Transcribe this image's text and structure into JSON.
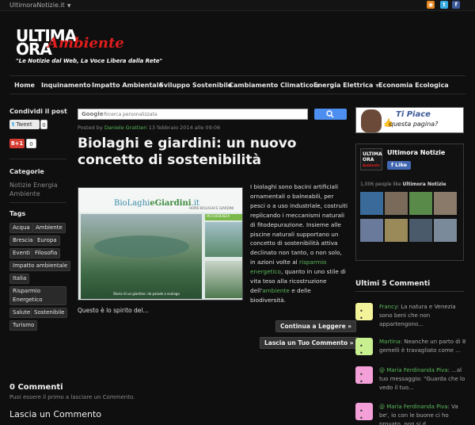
{
  "topbar": {
    "site_switch": "UltimoraNotizie.it"
  },
  "logo": {
    "ultima": "ULTIMA",
    "ora": "ORA",
    "ambiente": "Ambiente",
    "tagline": "\"Le Notizie dal Web, La Voce Libera dalla Rete\""
  },
  "nav": [
    {
      "label": "Home"
    },
    {
      "label": "Inquinamento"
    },
    {
      "label": "Impatto Ambientale"
    },
    {
      "label": "Sviluppo Sostenibile"
    },
    {
      "label": "Cambiamento Climatico"
    },
    {
      "label": "Energia Elettrica"
    },
    {
      "label": "Economia Ecologica"
    }
  ],
  "left": {
    "share_heading": "Condividi il post",
    "tweet_label": "Tweet",
    "tweet_count": "0",
    "gplus_label": "8+1",
    "gplus_count": "0",
    "categories_heading": "Categorie",
    "category": "Notizie Energia Ambiente",
    "tags_heading": "Tags",
    "tags": [
      "Acqua",
      "Ambiente",
      "Brescia",
      "Europa",
      "Eventi",
      "Filosofia",
      "Impatto ambientale",
      "Italia",
      "Risparmio Energetico",
      "Salute",
      "Sostenibile",
      "Turismo"
    ]
  },
  "search": {
    "brand": "Google",
    "placeholder": "Ricerca personalizzata"
  },
  "post": {
    "meta_prefix": "Posted by",
    "author": "Daniele Grattieri",
    "date": "13 febbraio 2014 alle 09:06",
    "title": "Biolaghi e giardini: un nuovo concetto di sostenibilità",
    "image": {
      "brand_a": "BioLaghi",
      "brand_b": "eGiardini",
      "brand_c": ".it",
      "menu": "HOME     BIOLAGHI E GIARDINI",
      "evidenza": "IN EVIDENZA",
      "caption": "Storia di un giardino: da palude a ecolago"
    },
    "text_1": "I biolaghi sono bacini artificiali ornamentali o balneabili, per pesci o a uso industriale, costruiti replicando i meccanismi naturali di fitodepurazione. Insieme alle piscine naturali supportano un concetto di sostenibilità attiva declinato non tanto, o non solo, in azioni volte al ",
    "link_1": "risparmio energetico",
    "text_2": ", quanto in uno stile di vita teso alla ricostruzione dell'",
    "link_2": "ambiente",
    "text_3": " e delle biodiversità.",
    "excerpt_end": "Questo è lo spirito del…",
    "read_more": "Continua a Leggere »",
    "leave_comment_btn": "Lascia un Tuo Commento »"
  },
  "comments": {
    "heading": "0 Commenti",
    "sub": "Puoi essere il primo a lasciare un Commento.",
    "leave_heading": "Lascia un Commento"
  },
  "right": {
    "banner_l1": "Ti Piace",
    "banner_l2": "questa pagina?",
    "fb_logo_a": "ULTIMA",
    "fb_logo_b": "ORA",
    "fb_logo_c": "Ambiente",
    "fb_name": "Ultimora Notizie",
    "fb_like": "Like",
    "fb_count": "1,006 people like",
    "fb_page": "Ultimora Notizie",
    "recent_heading": "Ultimi 5 Commenti",
    "recent": [
      {
        "who": "Francy",
        "text": ": La natura e Venezia sono beni che non appartengono...",
        "color": "#f3f39a"
      },
      {
        "who": "Martina",
        "text": ": Neanche un parto di 8 gemelli è travagliato come ...",
        "color": "#c9f090"
      },
      {
        "who": "@ Maria Ferdinanda Piva",
        "text": ": ...al tuo messaggio: \"Guarda che lo vedo il tuo...",
        "color": "#f3a0d8"
      },
      {
        "who": "@ Maria Ferdinanda Piva",
        "text": ": Va be', io con le buone ci ho provato, non si d...",
        "color": "#f3a0d8"
      }
    ]
  }
}
